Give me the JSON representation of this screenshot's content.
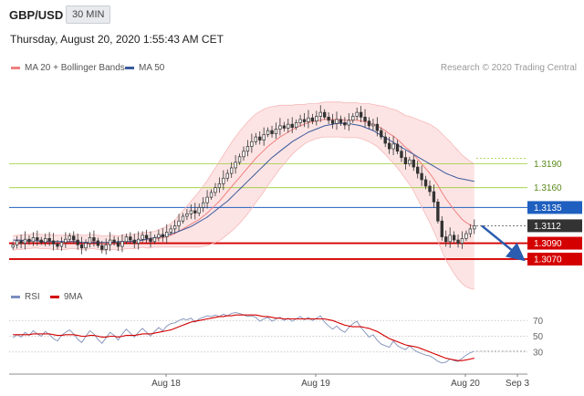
{
  "header": {
    "symbol": "GBP/USD",
    "timeframe": "30 MIN",
    "datetime": "Thursday, August 20, 2020 1:55:43 AM CET"
  },
  "legend": {
    "bollinger": "MA 20 + Bollinger Bands",
    "ma50": "MA 50",
    "copyright": "Research © 2020 Trading Central"
  },
  "rsi_legend": {
    "rsi": "RSI",
    "ma": "9MA"
  },
  "colors": {
    "bollinger": "#f08080",
    "band_fill": "#fde3e3",
    "ma50": "#3a5a9c",
    "support": "#d40000",
    "pivot": "#1f5fbf",
    "resistance": "#9acd32",
    "resistance_text": "#5a8a1a",
    "current": "#333333",
    "arrow": "#2a5db0"
  },
  "chart_data": {
    "price": {
      "type": "candlestick",
      "x_ticks": [
        "Aug 18",
        "Aug 19",
        "Aug 20",
        "Sep 3"
      ],
      "ylim": [
        1.304,
        1.33
      ],
      "levels": [
        {
          "label": "1.3190",
          "value": 1.319,
          "kind": "resistance"
        },
        {
          "label": "1.3160",
          "value": 1.316,
          "kind": "resistance"
        },
        {
          "label": "1.3135",
          "value": 1.3135,
          "kind": "pivot"
        },
        {
          "label": "1.3112",
          "value": 1.3112,
          "kind": "current"
        },
        {
          "label": "1.3090",
          "value": 1.309,
          "kind": "support"
        },
        {
          "label": "1.3070",
          "value": 1.307,
          "kind": "support"
        }
      ],
      "close": [
        1.3088,
        1.3093,
        1.309,
        1.3095,
        1.3092,
        1.3097,
        1.3094,
        1.3091,
        1.3096,
        1.3093,
        1.3089,
        1.3086,
        1.3091,
        1.3095,
        1.3099,
        1.3094,
        1.3088,
        1.3084,
        1.309,
        1.3097,
        1.3093,
        1.3087,
        1.3082,
        1.3088,
        1.3094,
        1.3091,
        1.3086,
        1.3092,
        1.3098,
        1.3094,
        1.309,
        1.3095,
        1.31,
        1.3096,
        1.3092,
        1.3097,
        1.3101,
        1.3098,
        1.3104,
        1.3108,
        1.3112,
        1.3118,
        1.3124,
        1.3127,
        1.3131,
        1.3128,
        1.3135,
        1.3141,
        1.3148,
        1.3154,
        1.316,
        1.3165,
        1.3172,
        1.3178,
        1.3185,
        1.3192,
        1.3199,
        1.3206,
        1.3212,
        1.3218,
        1.3224,
        1.322,
        1.3227,
        1.3232,
        1.3228,
        1.3234,
        1.3238,
        1.3235,
        1.324,
        1.3236,
        1.3242,
        1.3246,
        1.3243,
        1.3248,
        1.3244,
        1.325,
        1.3255,
        1.3249,
        1.3245,
        1.3241,
        1.3246,
        1.3242,
        1.3239,
        1.3245,
        1.325,
        1.3255,
        1.3249,
        1.3244,
        1.3238,
        1.324,
        1.3232,
        1.3224,
        1.3216,
        1.3209,
        1.3215,
        1.3206,
        1.3198,
        1.319,
        1.3195,
        1.3186,
        1.3178,
        1.317,
        1.3162,
        1.3155,
        1.3142,
        1.3118,
        1.3098,
        1.3092,
        1.31,
        1.3094,
        1.309,
        1.3096,
        1.3102,
        1.3108,
        1.3112
      ],
      "bollinger_mid": [
        1.309,
        1.3091,
        1.3091,
        1.3092,
        1.3092,
        1.3093,
        1.3093,
        1.3092,
        1.3092,
        1.3092,
        1.3091,
        1.3091,
        1.3091,
        1.3091,
        1.3092,
        1.3092,
        1.3092,
        1.3091,
        1.3091,
        1.3092,
        1.3092,
        1.3091,
        1.309,
        1.309,
        1.3091,
        1.3091,
        1.309,
        1.3091,
        1.3092,
        1.3092,
        1.3092,
        1.3093,
        1.3094,
        1.3094,
        1.3094,
        1.3095,
        1.3096,
        1.3097,
        1.3098,
        1.31,
        1.3102,
        1.3105,
        1.3108,
        1.3111,
        1.3114,
        1.3117,
        1.312,
        1.3124,
        1.3128,
        1.3133,
        1.3138,
        1.3143,
        1.3149,
        1.3155,
        1.3161,
        1.3167,
        1.3173,
        1.3179,
        1.3185,
        1.3191,
        1.3197,
        1.3202,
        1.3207,
        1.3212,
        1.3216,
        1.322,
        1.3224,
        1.3227,
        1.323,
        1.3233,
        1.3236,
        1.3238,
        1.324,
        1.3242,
        1.3243,
        1.3244,
        1.3245,
        1.3246,
        1.3246,
        1.3246,
        1.3246,
        1.3246,
        1.3245,
        1.3245,
        1.3245,
        1.3245,
        1.3244,
        1.3243,
        1.3242,
        1.324,
        1.3238,
        1.3235,
        1.3232,
        1.3228,
        1.3225,
        1.3221,
        1.3216,
        1.3211,
        1.3207,
        1.3202,
        1.3196,
        1.319,
        1.3184,
        1.3178,
        1.3171,
        1.3163,
        1.3154,
        1.3146,
        1.3139,
        1.3132,
        1.3126,
        1.312,
        1.3116,
        1.3113,
        1.3111
      ],
      "bollinger_halfwidth": [
        0.0009,
        0.0009,
        0.0009,
        0.0009,
        0.0009,
        0.0009,
        0.0009,
        0.0009,
        0.0009,
        0.0009,
        0.0009,
        0.0009,
        0.0009,
        0.0009,
        0.0009,
        0.0009,
        0.0009,
        0.0009,
        0.0009,
        0.0009,
        0.0009,
        0.0009,
        0.0009,
        0.0009,
        0.0009,
        0.0009,
        0.0009,
        0.0009,
        0.0009,
        0.0009,
        0.0009,
        0.0009,
        0.0009,
        0.001,
        0.001,
        0.001,
        0.0011,
        0.0012,
        0.0013,
        0.0015,
        0.0017,
        0.002,
        0.0023,
        0.0026,
        0.0029,
        0.0032,
        0.0035,
        0.0038,
        0.0041,
        0.0044,
        0.0047,
        0.005,
        0.0052,
        0.0054,
        0.0056,
        0.0057,
        0.0058,
        0.0058,
        0.0058,
        0.0057,
        0.0056,
        0.0054,
        0.0052,
        0.0049,
        0.0046,
        0.0043,
        0.004,
        0.0037,
        0.0034,
        0.0031,
        0.0029,
        0.0027,
        0.0025,
        0.0024,
        0.0023,
        0.0022,
        0.0022,
        0.0022,
        0.0022,
        0.0022,
        0.0022,
        0.0022,
        0.0022,
        0.0022,
        0.0022,
        0.0022,
        0.0022,
        0.0023,
        0.0024,
        0.0025,
        0.0026,
        0.0028,
        0.003,
        0.0032,
        0.0034,
        0.0036,
        0.0038,
        0.004,
        0.0043,
        0.0046,
        0.005,
        0.0054,
        0.0058,
        0.0062,
        0.0066,
        0.007,
        0.0074,
        0.0077,
        0.0079,
        0.008,
        0.0081,
        0.0081,
        0.0081,
        0.008,
        0.0079
      ],
      "ma50": [
        1.3094,
        1.3094,
        1.3094,
        1.3093,
        1.3093,
        1.3093,
        1.3093,
        1.3092,
        1.3092,
        1.3092,
        1.3092,
        1.3092,
        1.3092,
        1.3092,
        1.3092,
        1.3092,
        1.3092,
        1.3091,
        1.3091,
        1.3091,
        1.3091,
        1.3091,
        1.3091,
        1.3091,
        1.3091,
        1.3091,
        1.3092,
        1.3092,
        1.3092,
        1.3092,
        1.3093,
        1.3093,
        1.3094,
        1.3095,
        1.3096,
        1.3097,
        1.3098,
        1.3099,
        1.31,
        1.3102,
        1.3103,
        1.3105,
        1.3107,
        1.3109,
        1.3111,
        1.3114,
        1.3117,
        1.312,
        1.3123,
        1.3127,
        1.3131,
        1.3135,
        1.3139,
        1.3143,
        1.3148,
        1.3153,
        1.3158,
        1.3163,
        1.3168,
        1.3173,
        1.3178,
        1.3183,
        1.3188,
        1.3193,
        1.3198,
        1.3202,
        1.3206,
        1.321,
        1.3214,
        1.3218,
        1.3221,
        1.3224,
        1.3227,
        1.323,
        1.3232,
        1.3234,
        1.3236,
        1.3238,
        1.3239,
        1.324,
        1.3241,
        1.3241,
        1.3241,
        1.3241,
        1.324,
        1.3239,
        1.3238,
        1.3236,
        1.3234,
        1.3232,
        1.3229,
        1.3226,
        1.3223,
        1.322,
        1.3217,
        1.3214,
        1.3211,
        1.3208,
        1.3205,
        1.3202,
        1.3199,
        1.3196,
        1.3193,
        1.319,
        1.3187,
        1.3184,
        1.3181,
        1.3178,
        1.3176,
        1.3174,
        1.3172,
        1.3171,
        1.317,
        1.3169,
        1.3168
      ],
      "forecast": {
        "from": 1.3112,
        "to": 1.307
      }
    },
    "rsi": {
      "type": "line",
      "ylim": [
        10,
        90
      ],
      "y_ticks": [
        70,
        50,
        30
      ],
      "rsi": [
        48,
        52,
        49,
        55,
        51,
        57,
        53,
        50,
        56,
        52,
        47,
        44,
        51,
        55,
        58,
        53,
        46,
        42,
        50,
        57,
        53,
        46,
        41,
        48,
        55,
        51,
        45,
        53,
        59,
        54,
        49,
        55,
        60,
        55,
        50,
        56,
        61,
        57,
        63,
        66,
        67,
        70,
        72,
        71,
        73,
        68,
        72,
        74,
        76,
        75,
        77,
        75,
        78,
        76,
        79,
        80,
        79,
        77,
        75,
        76,
        74,
        69,
        72,
        74,
        69,
        72,
        74,
        70,
        73,
        69,
        72,
        75,
        71,
        74,
        70,
        73,
        76,
        68,
        63,
        59,
        63,
        58,
        55,
        61,
        66,
        69,
        61,
        55,
        49,
        52,
        45,
        40,
        38,
        36,
        44,
        38,
        35,
        33,
        38,
        33,
        30,
        28,
        26,
        25,
        22,
        18,
        16,
        17,
        21,
        19,
        18,
        22,
        26,
        29,
        31
      ],
      "ma9": [
        52,
        52,
        52,
        52,
        52,
        53,
        53,
        53,
        53,
        53,
        52,
        51,
        51,
        52,
        52,
        52,
        51,
        50,
        50,
        51,
        51,
        50,
        49,
        49,
        50,
        50,
        49,
        50,
        51,
        51,
        51,
        52,
        53,
        53,
        53,
        54,
        55,
        56,
        57,
        58,
        60,
        62,
        64,
        66,
        68,
        69,
        70,
        71,
        72,
        73,
        74,
        75,
        75,
        76,
        76,
        77,
        77,
        77,
        77,
        77,
        77,
        76,
        75,
        75,
        74,
        73,
        73,
        72,
        72,
        72,
        72,
        72,
        72,
        72,
        72,
        72,
        72,
        72,
        71,
        70,
        68,
        66,
        64,
        63,
        62,
        62,
        62,
        61,
        60,
        58,
        56,
        53,
        50,
        47,
        45,
        43,
        41,
        39,
        38,
        37,
        36,
        34,
        32,
        30,
        28,
        26,
        24,
        22,
        21,
        20,
        19,
        19,
        20,
        21,
        22
      ]
    }
  }
}
